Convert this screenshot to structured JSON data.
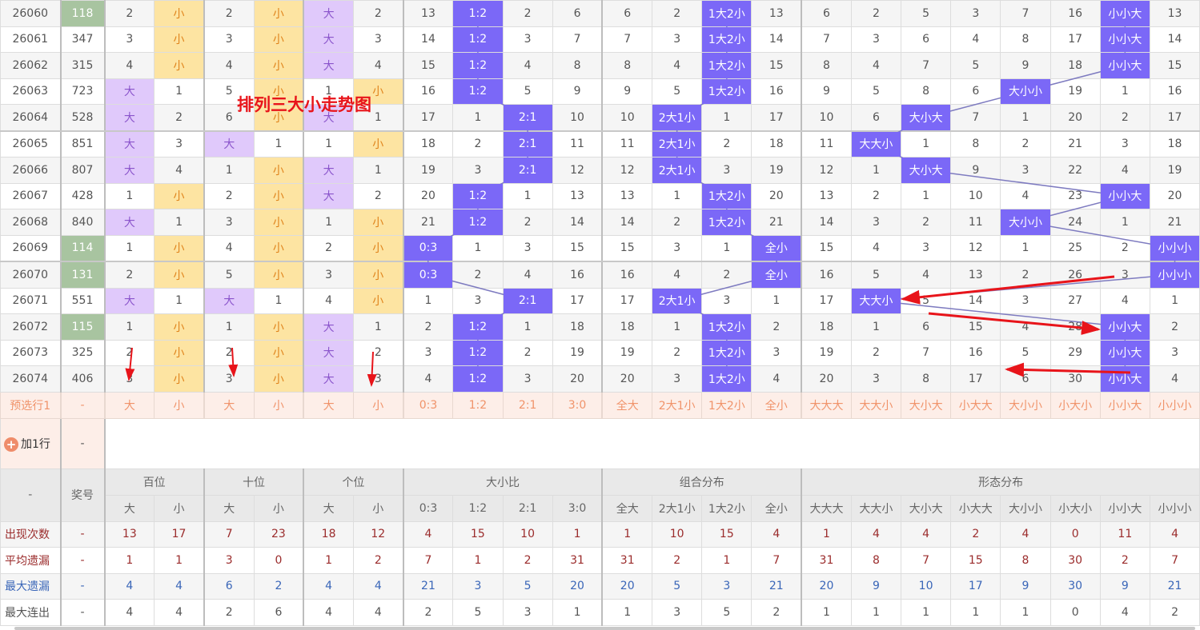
{
  "title_overlay": "排列三大小走势图",
  "colors": {
    "pair": "#a8c4a0",
    "big": "#e0c9fb",
    "small": "#fde4a2",
    "hit": "#7b68f7",
    "line": "#7e7bc0",
    "arrow": "#e8141a"
  },
  "rows": [
    {
      "issue": "26060",
      "number": "118",
      "pair": true,
      "cells": [
        "2",
        "小",
        "2",
        "小",
        "大",
        "2",
        "13",
        "1:2",
        "2",
        "6",
        "6",
        "2",
        "1大2小",
        "13",
        "6",
        "2",
        "5",
        "3",
        "7",
        "16",
        "小小大",
        "13"
      ]
    },
    {
      "issue": "26061",
      "number": "347",
      "pair": false,
      "cells": [
        "3",
        "小",
        "3",
        "小",
        "大",
        "3",
        "14",
        "1:2",
        "3",
        "7",
        "7",
        "3",
        "1大2小",
        "14",
        "7",
        "3",
        "6",
        "4",
        "8",
        "17",
        "小小大",
        "14"
      ]
    },
    {
      "issue": "26062",
      "number": "315",
      "pair": false,
      "cells": [
        "4",
        "小",
        "4",
        "小",
        "大",
        "4",
        "15",
        "1:2",
        "4",
        "8",
        "8",
        "4",
        "1大2小",
        "15",
        "8",
        "4",
        "7",
        "5",
        "9",
        "18",
        "小小大",
        "15"
      ]
    },
    {
      "issue": "26063",
      "number": "723",
      "pair": false,
      "cells": [
        "大",
        "1",
        "5",
        "小",
        "1",
        "小",
        "16",
        "1:2",
        "5",
        "9",
        "9",
        "5",
        "1大2小",
        "16",
        "9",
        "5",
        "8",
        "6",
        "大小小",
        "19",
        "1",
        "16"
      ]
    },
    {
      "issue": "26064",
      "number": "528",
      "pair": false,
      "cells": [
        "大",
        "2",
        "6",
        "小",
        "大",
        "1",
        "17",
        "1",
        "2:1",
        "10",
        "10",
        "2大1小",
        "1",
        "17",
        "10",
        "6",
        "大小大",
        "7",
        "1",
        "20",
        "2",
        "17"
      ]
    },
    {
      "issue": "26065",
      "number": "851",
      "pair": false,
      "cells": [
        "大",
        "3",
        "大",
        "1",
        "1",
        "小",
        "18",
        "2",
        "2:1",
        "11",
        "11",
        "2大1小",
        "2",
        "18",
        "11",
        "大大小",
        "1",
        "8",
        "2",
        "21",
        "3",
        "18"
      ]
    },
    {
      "issue": "26066",
      "number": "807",
      "pair": false,
      "cells": [
        "大",
        "4",
        "1",
        "小",
        "大",
        "1",
        "19",
        "3",
        "2:1",
        "12",
        "12",
        "2大1小",
        "3",
        "19",
        "12",
        "1",
        "大小大",
        "9",
        "3",
        "22",
        "4",
        "19"
      ]
    },
    {
      "issue": "26067",
      "number": "428",
      "pair": false,
      "cells": [
        "1",
        "小",
        "2",
        "小",
        "大",
        "2",
        "20",
        "1:2",
        "1",
        "13",
        "13",
        "1",
        "1大2小",
        "20",
        "13",
        "2",
        "1",
        "10",
        "4",
        "23",
        "小小大",
        "20"
      ]
    },
    {
      "issue": "26068",
      "number": "840",
      "pair": false,
      "cells": [
        "大",
        "1",
        "3",
        "小",
        "1",
        "小",
        "21",
        "1:2",
        "2",
        "14",
        "14",
        "2",
        "1大2小",
        "21",
        "14",
        "3",
        "2",
        "11",
        "大小小",
        "24",
        "1",
        "21"
      ]
    },
    {
      "issue": "26069",
      "number": "114",
      "pair": true,
      "cells": [
        "1",
        "小",
        "4",
        "小",
        "2",
        "小",
        "0:3",
        "1",
        "3",
        "15",
        "15",
        "3",
        "1",
        "全小",
        "15",
        "4",
        "3",
        "12",
        "1",
        "25",
        "2",
        "小小小"
      ]
    },
    {
      "issue": "26070",
      "number": "131",
      "pair": true,
      "cells": [
        "2",
        "小",
        "5",
        "小",
        "3",
        "小",
        "0:3",
        "2",
        "4",
        "16",
        "16",
        "4",
        "2",
        "全小",
        "16",
        "5",
        "4",
        "13",
        "2",
        "26",
        "3",
        "小小小"
      ]
    },
    {
      "issue": "26071",
      "number": "551",
      "pair": false,
      "cells": [
        "大",
        "1",
        "大",
        "1",
        "4",
        "小",
        "1",
        "3",
        "2:1",
        "17",
        "17",
        "2大1小",
        "3",
        "1",
        "17",
        "大大小",
        "5",
        "14",
        "3",
        "27",
        "4",
        "1"
      ]
    },
    {
      "issue": "26072",
      "number": "115",
      "pair": true,
      "cells": [
        "1",
        "小",
        "1",
        "小",
        "大",
        "1",
        "2",
        "1:2",
        "1",
        "18",
        "18",
        "1",
        "1大2小",
        "2",
        "18",
        "1",
        "6",
        "15",
        "4",
        "28",
        "小小大",
        "2"
      ]
    },
    {
      "issue": "26073",
      "number": "325",
      "pair": false,
      "cells": [
        "2",
        "小",
        "2",
        "小",
        "大",
        "2",
        "3",
        "1:2",
        "2",
        "19",
        "19",
        "2",
        "1大2小",
        "3",
        "19",
        "2",
        "7",
        "16",
        "5",
        "29",
        "小小大",
        "3"
      ]
    },
    {
      "issue": "26074",
      "number": "406",
      "pair": false,
      "cells": [
        "3",
        "小",
        "3",
        "小",
        "大",
        "3",
        "4",
        "1:2",
        "3",
        "20",
        "20",
        "3",
        "1大2小",
        "4",
        "20",
        "3",
        "8",
        "17",
        "6",
        "30",
        "小小大",
        "4"
      ]
    }
  ],
  "preselect": {
    "label": "预选行1",
    "number": "-",
    "cells": [
      "大",
      "小",
      "大",
      "小",
      "大",
      "小",
      "0:3",
      "1:2",
      "2:1",
      "3:0",
      "全大",
      "2大1小",
      "1大2小",
      "全小",
      "大大大",
      "大大小",
      "大小大",
      "小大大",
      "大小小",
      "小大小",
      "小小大",
      "小小小"
    ]
  },
  "add_row": {
    "label": "加1行",
    "number": "-"
  },
  "header": {
    "corner": "-",
    "number": "奖号",
    "groups": [
      {
        "label": "百位",
        "span": 2
      },
      {
        "label": "十位",
        "span": 2
      },
      {
        "label": "个位",
        "span": 2
      },
      {
        "label": "大小比",
        "span": 4
      },
      {
        "label": "组合分布",
        "span": 4
      },
      {
        "label": "形态分布",
        "span": 8
      }
    ],
    "sub": [
      "大",
      "小",
      "大",
      "小",
      "大",
      "小",
      "0:3",
      "1:2",
      "2:1",
      "3:0",
      "全大",
      "2大1小",
      "1大2小",
      "全小",
      "大大大",
      "大大小",
      "大小大",
      "小大大",
      "大小小",
      "小大小",
      "小小大",
      "小小小"
    ]
  },
  "stats": [
    {
      "label": "出现次数",
      "number": "-",
      "values": [
        "13",
        "17",
        "7",
        "23",
        "18",
        "12",
        "4",
        "15",
        "10",
        "1",
        "1",
        "10",
        "15",
        "4",
        "1",
        "4",
        "4",
        "2",
        "4",
        "0",
        "11",
        "4"
      ]
    },
    {
      "label": "平均遗漏",
      "number": "-",
      "values": [
        "1",
        "1",
        "3",
        "0",
        "1",
        "2",
        "7",
        "1",
        "2",
        "31",
        "31",
        "2",
        "1",
        "7",
        "31",
        "8",
        "7",
        "15",
        "8",
        "30",
        "2",
        "7"
      ]
    },
    {
      "label": "最大遗漏",
      "number": "-",
      "values": [
        "4",
        "4",
        "6",
        "2",
        "4",
        "4",
        "21",
        "3",
        "5",
        "20",
        "20",
        "5",
        "3",
        "21",
        "20",
        "9",
        "10",
        "17",
        "9",
        "30",
        "9",
        "21"
      ]
    },
    {
      "label": "最大连出",
      "number": "-",
      "values": [
        "4",
        "4",
        "2",
        "6",
        "4",
        "4",
        "2",
        "5",
        "3",
        "1",
        "1",
        "3",
        "5",
        "2",
        "1",
        "1",
        "1",
        "1",
        "1",
        "0",
        "4",
        "2"
      ]
    }
  ]
}
